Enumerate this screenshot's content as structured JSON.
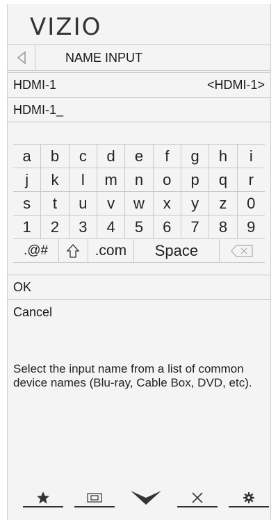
{
  "brand": {
    "logo_text": "VIZIO"
  },
  "header": {
    "title": "NAME INPUT",
    "back_icon": "back-triangle-icon"
  },
  "input": {
    "label": "HDMI-1",
    "current_value": "<HDMI-1>"
  },
  "text_entry": {
    "value": "HDMI-1_"
  },
  "keyboard": {
    "rows": [
      [
        "a",
        "b",
        "c",
        "d",
        "e",
        "f",
        "g",
        "h",
        "i"
      ],
      [
        "j",
        "k",
        "l",
        "m",
        "n",
        "o",
        "p",
        "q",
        "r"
      ],
      [
        "s",
        "t",
        "u",
        "v",
        "w",
        "x",
        "y",
        "z",
        "0"
      ],
      [
        "1",
        "2",
        "3",
        "4",
        "5",
        "6",
        "7",
        "8",
        "9"
      ]
    ],
    "special": {
      "symbols": ".@#",
      "dotcom": ".com",
      "space": "Space"
    }
  },
  "actions": {
    "ok": "OK",
    "cancel": "Cancel"
  },
  "help_text": "Select the input name from a list of common device names (Blu-ray, Cable Box, DVD, etc).",
  "bottom_nav": [
    {
      "icon": "star-icon"
    },
    {
      "icon": "aspect-ratio-icon"
    },
    {
      "icon": "chevron-down-icon"
    },
    {
      "icon": "close-icon"
    },
    {
      "icon": "gear-icon"
    }
  ]
}
